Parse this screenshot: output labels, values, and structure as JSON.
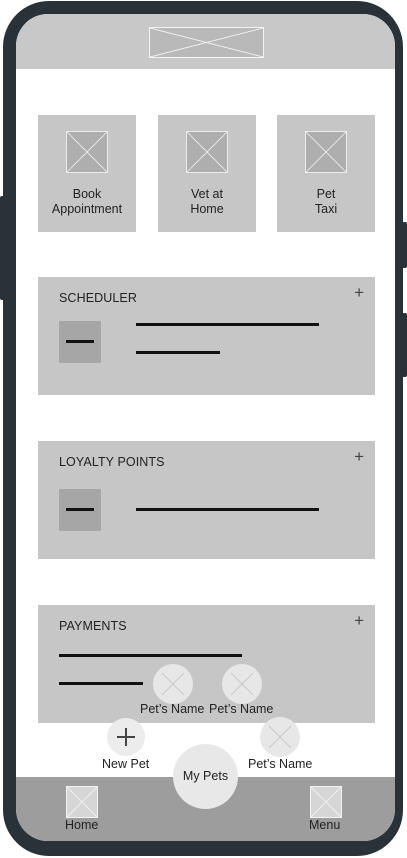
{
  "tiles": [
    {
      "label": "Book\nAppointment"
    },
    {
      "label": "Vet at\nHome"
    },
    {
      "label": "Pet\nTaxi"
    }
  ],
  "cards": {
    "scheduler": {
      "title": "SCHEDULER",
      "add": "+"
    },
    "loyalty": {
      "title": "LOYALTY POINTS",
      "add": "+"
    },
    "payments": {
      "title": "PAYMENTS",
      "add": "+"
    }
  },
  "pets_menu": {
    "pet1": "Pet’s Name",
    "pet2": "Pet’s Name",
    "pet3": "Pet’s Name",
    "new_pet": "New Pet",
    "new_pet_icon": "+",
    "my_pets": "My Pets"
  },
  "nav": {
    "home": "Home",
    "menu": "Menu"
  },
  "icons": {
    "logo": "image-placeholder-icon",
    "tile": "image-placeholder-icon",
    "pet": "pet-avatar-placeholder-icon",
    "add": "plus-icon",
    "collapse": "minus-icon"
  },
  "colors": {
    "frame": "#283238",
    "panel": "#c6c6c6",
    "nav": "#9d9d9d"
  }
}
